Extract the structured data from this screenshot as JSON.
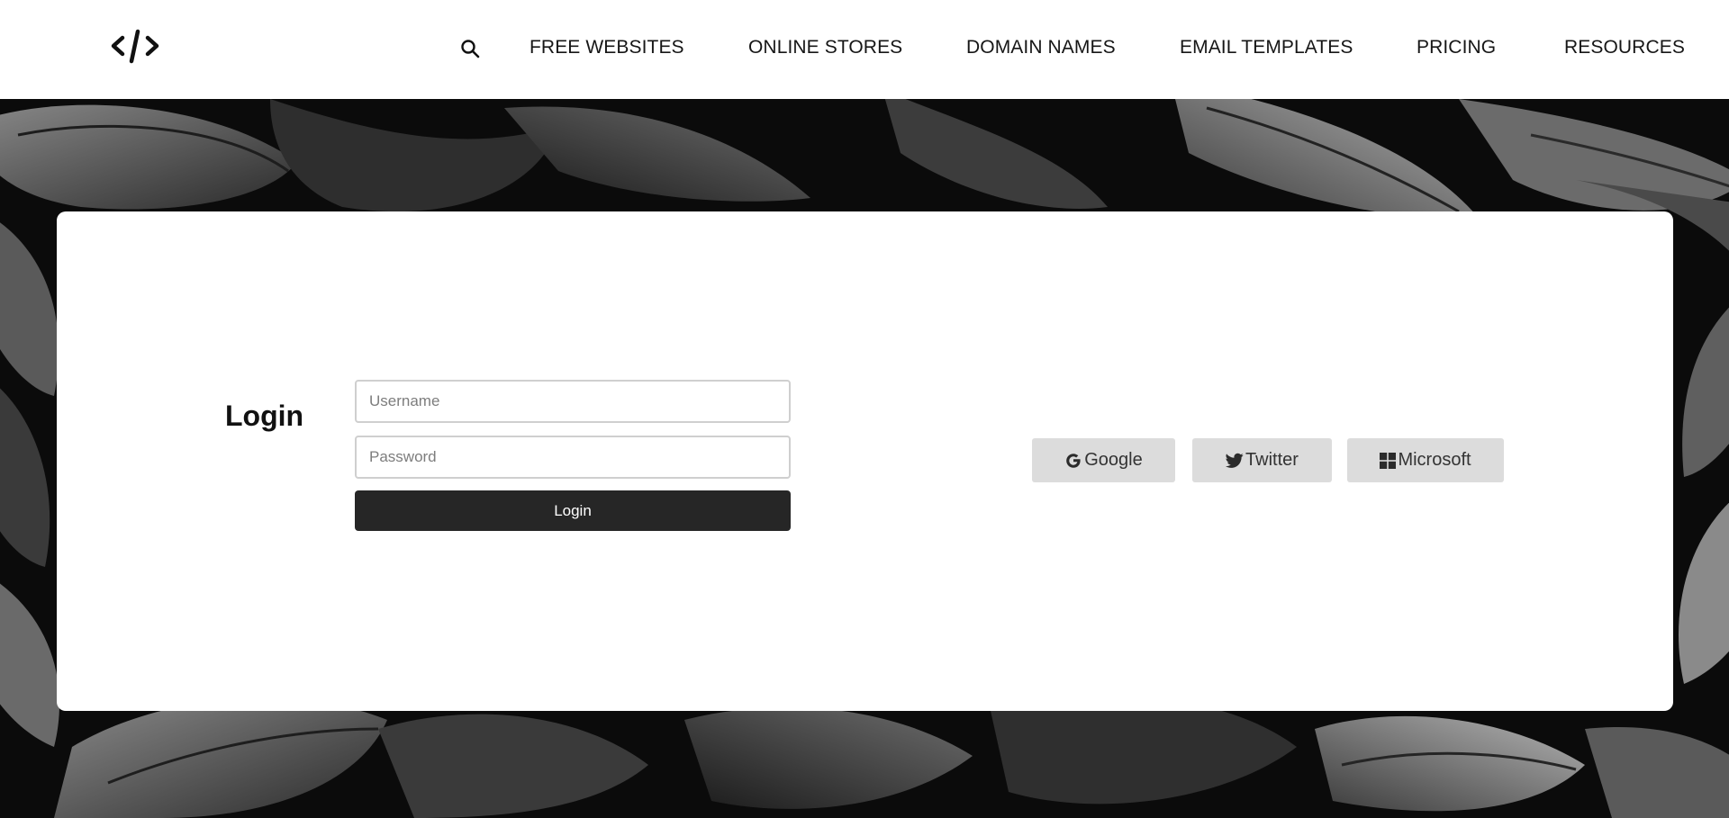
{
  "header": {
    "logo_icon": "code-brackets-icon",
    "search_icon": "search-icon",
    "nav": [
      {
        "label": "FREE WEBSITES"
      },
      {
        "label": "ONLINE STORES"
      },
      {
        "label": "DOMAIN NAMES"
      },
      {
        "label": "EMAIL TEMPLATES"
      },
      {
        "label": "PRICING"
      },
      {
        "label": "RESOURCES"
      }
    ]
  },
  "login": {
    "title": "Login",
    "username_placeholder": "Username",
    "password_placeholder": "Password",
    "submit_label": "Login"
  },
  "social": [
    {
      "label": "Google",
      "icon": "google-icon"
    },
    {
      "label": "Twitter",
      "icon": "twitter-icon"
    },
    {
      "label": "Microsoft",
      "icon": "microsoft-icon"
    }
  ],
  "colors": {
    "login_button": "#262626",
    "social_button": "#dcdcdc",
    "hero_background": "#0c0c0c"
  }
}
